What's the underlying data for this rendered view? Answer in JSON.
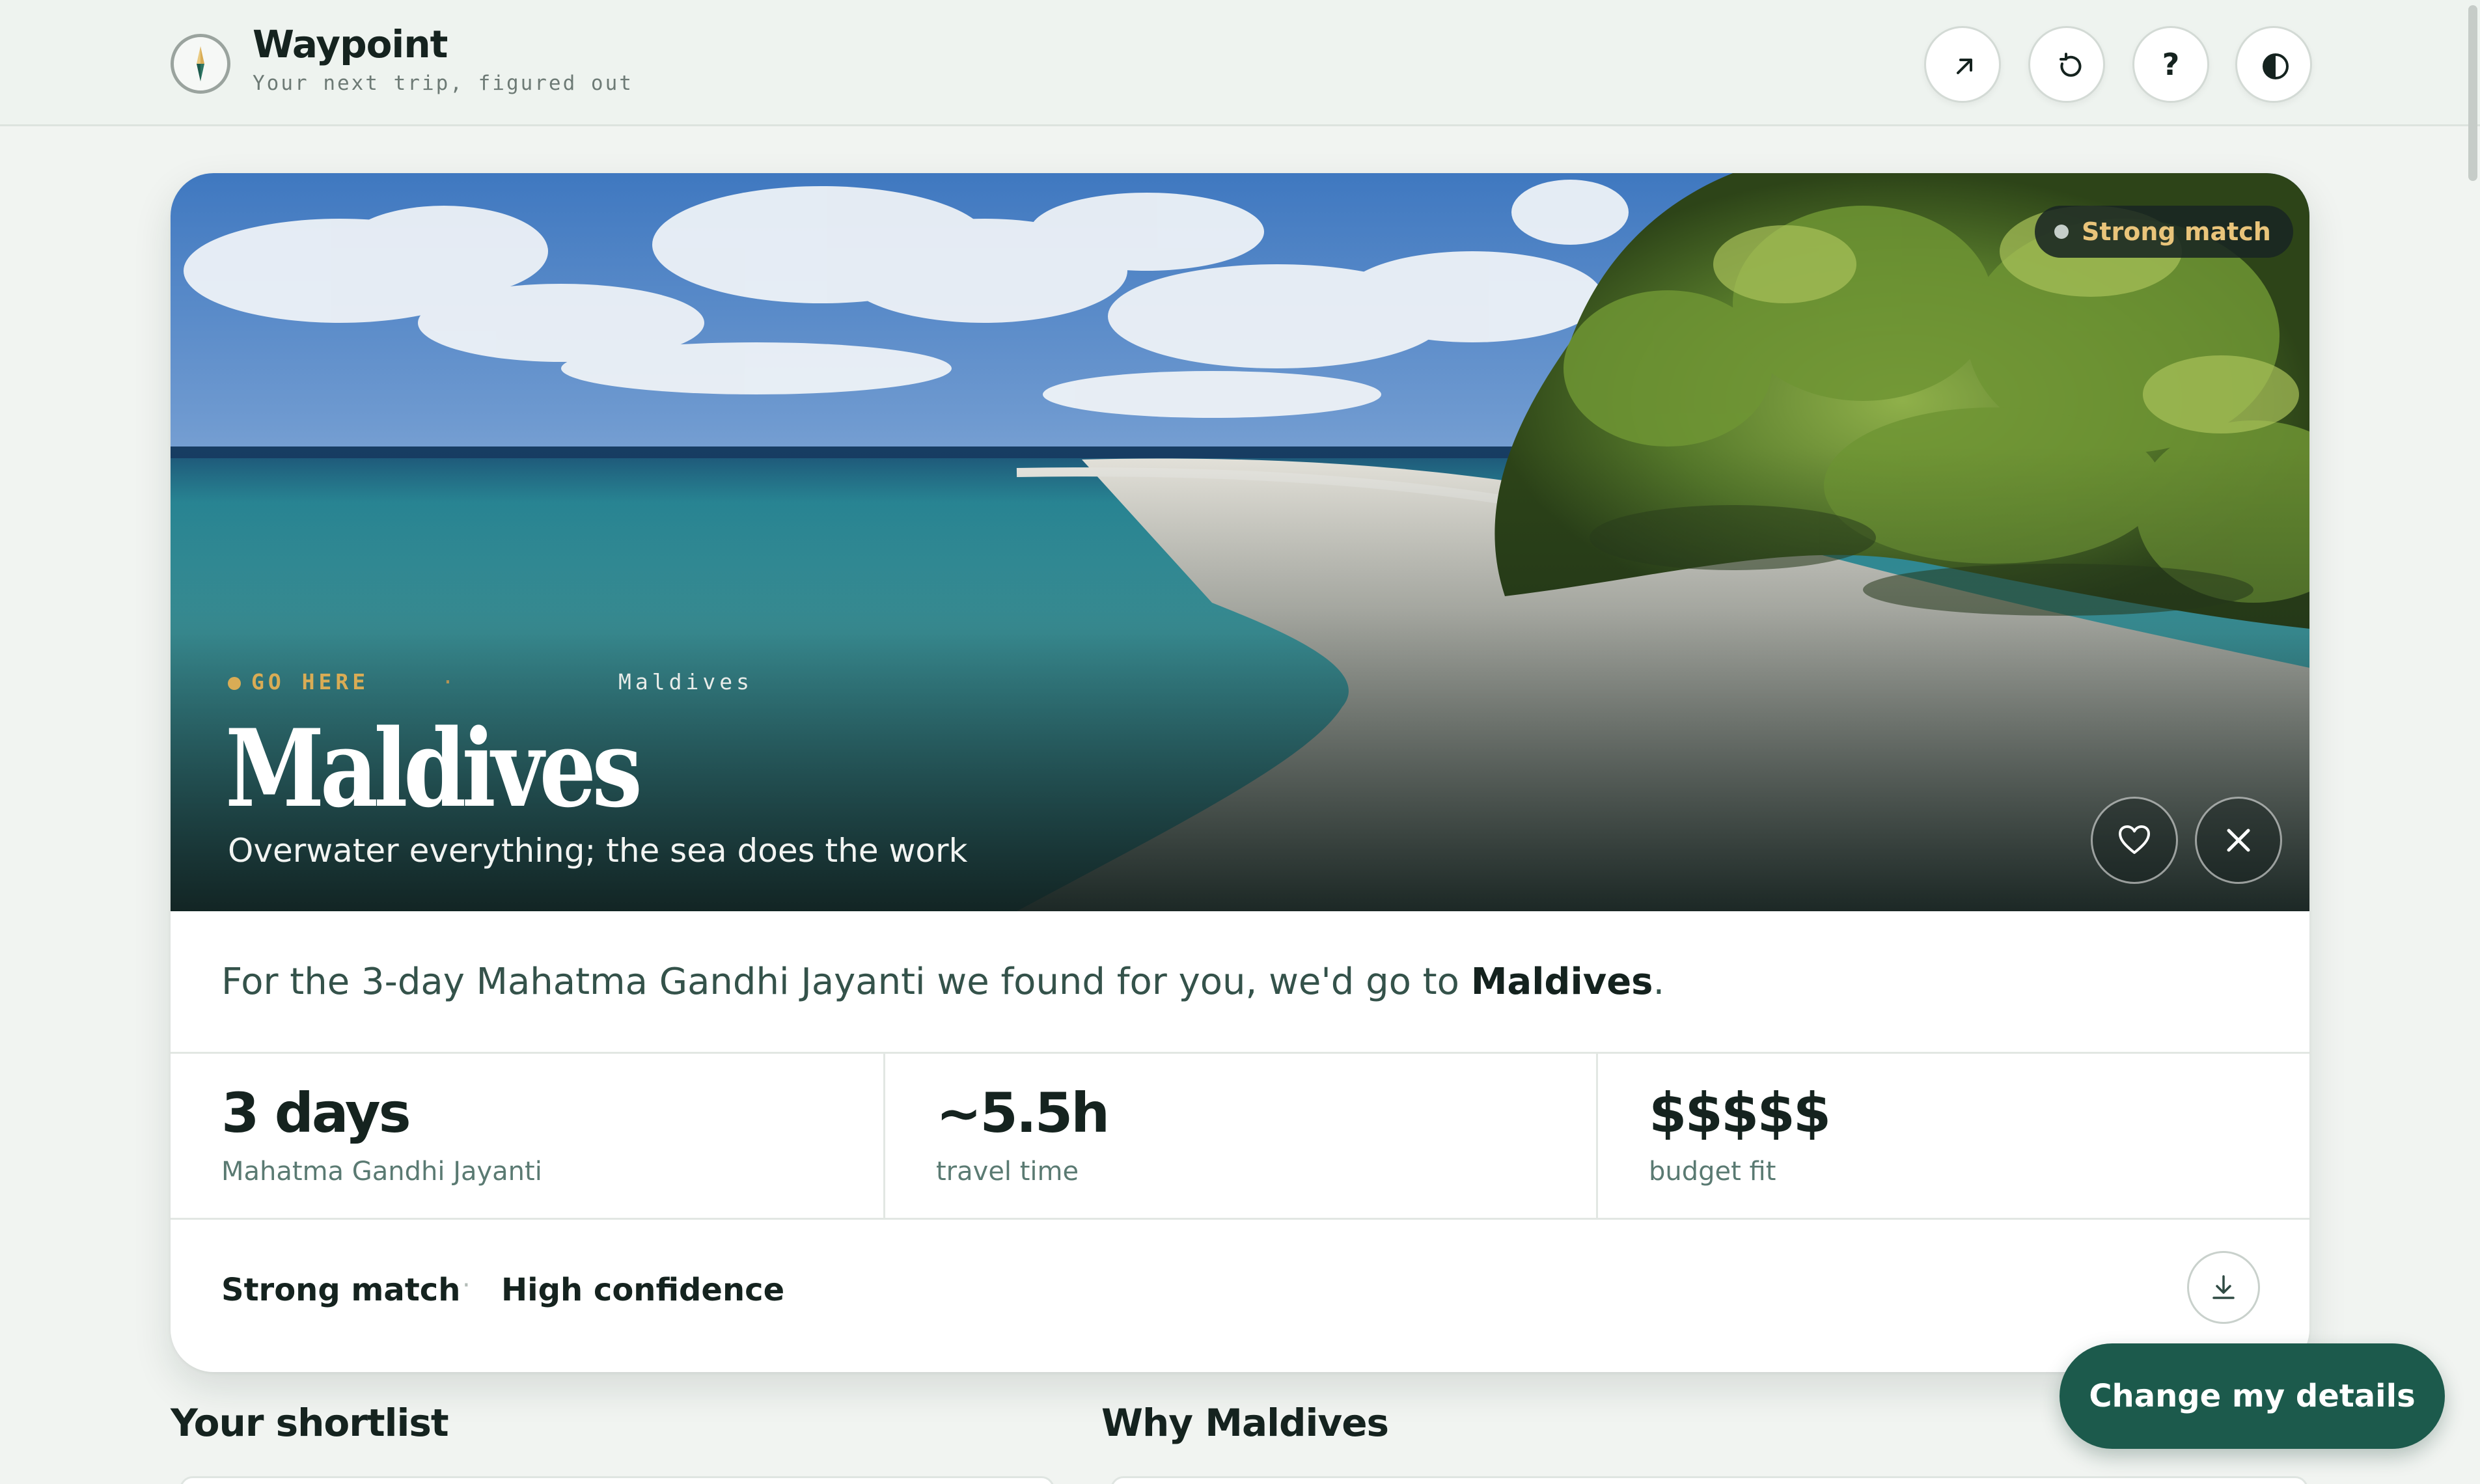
{
  "app": {
    "name": "Waypoint",
    "tagline": "Your next trip, figured out",
    "logo_icon": "compass-icon"
  },
  "header_actions": [
    {
      "icon": "share-arrow-icon"
    },
    {
      "icon": "restart-icon"
    },
    {
      "icon": "help-icon",
      "glyph": "?"
    },
    {
      "icon": "theme-toggle-icon"
    }
  ],
  "hero": {
    "badge": "Strong match",
    "eyebrow_kicker": "GO HERE",
    "eyebrow_sep": "·",
    "eyebrow_place": "Maldives",
    "title": "Maldives",
    "subtitle": "Overwater everything; the sea does the work",
    "actions": [
      {
        "icon": "heart-icon"
      },
      {
        "icon": "close-icon"
      }
    ]
  },
  "summary": {
    "prefix": "For the 3-day Mahatma Gandhi Jayanti we found for you, we'd go to ",
    "destination": "Maldives",
    "suffix": "."
  },
  "stats": [
    {
      "value": "3 days",
      "label": "Mahatma Gandhi Jayanti"
    },
    {
      "value": "~5.5h",
      "label": "travel time"
    },
    {
      "value": "$$$$$",
      "label": "budget fit"
    }
  ],
  "confidence": {
    "match": "Strong match",
    "separator": "·",
    "confidence": "High confidence",
    "download_icon": "download-icon"
  },
  "sections": {
    "shortlist": "Your shortlist",
    "why": "Why Maldives"
  },
  "cta": {
    "label": "Change my details"
  },
  "colors": {
    "accent": "#1c5a4c",
    "gold": "#d9ac55",
    "background": "#f1f4f1"
  }
}
